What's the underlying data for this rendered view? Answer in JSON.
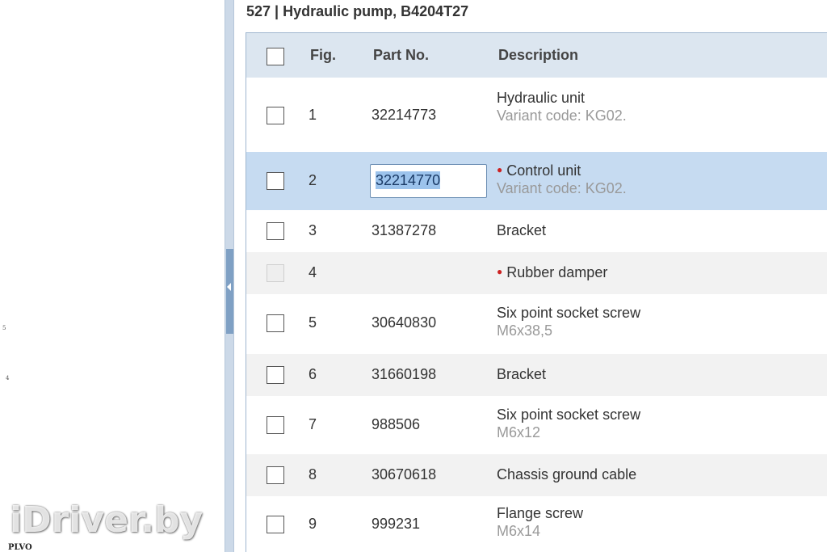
{
  "diagram": {
    "callouts": [
      "5",
      "4"
    ],
    "watermark": "iDriver.by",
    "bottom_tag": "PLVO"
  },
  "header": {
    "title": "527  |  Hydraulic pump, B4204T27"
  },
  "table": {
    "columns": {
      "fig": "Fig.",
      "part": "Part No.",
      "desc": "Description"
    },
    "rows": [
      {
        "fig": "1",
        "part": "32214773",
        "desc": "Hydraulic unit",
        "note": "Variant code: KG02.",
        "selected": false,
        "checkbox_enabled": true,
        "marker": false
      },
      {
        "fig": "2",
        "part": "32214770",
        "desc": "Control unit",
        "note": "Variant code: KG02.",
        "selected": true,
        "checkbox_enabled": true,
        "marker": true
      },
      {
        "fig": "3",
        "part": "31387278",
        "desc": "Bracket",
        "note": "",
        "selected": false,
        "checkbox_enabled": true,
        "marker": false
      },
      {
        "fig": "4",
        "part": "",
        "desc": "Rubber damper",
        "note": "",
        "selected": false,
        "checkbox_enabled": false,
        "marker": true
      },
      {
        "fig": "5",
        "part": "30640830",
        "desc": "Six point socket screw",
        "note": "M6x38,5",
        "selected": false,
        "checkbox_enabled": true,
        "marker": false
      },
      {
        "fig": "6",
        "part": "31660198",
        "desc": "Bracket",
        "note": "",
        "selected": false,
        "checkbox_enabled": true,
        "marker": false
      },
      {
        "fig": "7",
        "part": "988506",
        "desc": "Six point socket screw",
        "note": "M6x12",
        "selected": false,
        "checkbox_enabled": true,
        "marker": false
      },
      {
        "fig": "8",
        "part": "30670618",
        "desc": "Chassis ground cable",
        "note": "",
        "selected": false,
        "checkbox_enabled": true,
        "marker": false
      },
      {
        "fig": "9",
        "part": "999231",
        "desc": "Flange screw",
        "note": "M6x14",
        "selected": false,
        "checkbox_enabled": true,
        "marker": false
      }
    ]
  },
  "colors": {
    "header_bg": "#dce6f0",
    "selected_row": "#c6dbf1",
    "alt_row": "#f2f2f2",
    "marker_red": "#cc2222",
    "splitter": "#7fa0c4"
  },
  "icons": {
    "splitter_arrow": "chevron-left-icon",
    "row_marker": "red-dot-icon"
  }
}
